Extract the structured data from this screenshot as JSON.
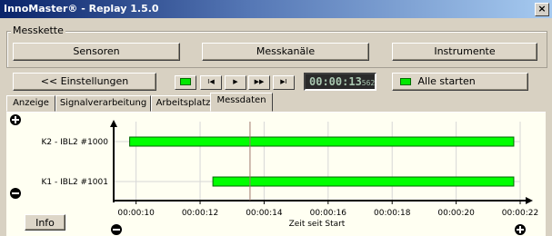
{
  "window": {
    "title": "InnoMaster® - Replay   1.5.0",
    "close_glyph": "×"
  },
  "group": {
    "label": "Messkette"
  },
  "buttons": {
    "sensoren": "Sensoren",
    "messkanaele": "Messkanäle",
    "instrumente": "Instrumente",
    "einstellungen": "<< Einstellungen",
    "alle_starten": "Alle starten",
    "info": "Info"
  },
  "media": {
    "rewind": "I◀",
    "play": "▶",
    "forward": "▶▶",
    "end": "▶I"
  },
  "timer": {
    "main": "00:00:13",
    "fraction": "562"
  },
  "tabs": [
    "Anzeige",
    "Signalverarbeitung",
    "Arbeitsplatz",
    "Messdaten"
  ],
  "active_tab": "Messdaten",
  "colors": {
    "bar": "#00ff00",
    "cursor": "#a0786e",
    "panel_bg": "#fffff2"
  },
  "chart_data": {
    "type": "gantt",
    "xlabel": "Zeit seit Start",
    "x_ticks": [
      "00:00:10",
      "00:00:12",
      "00:00:14",
      "00:00:16",
      "00:00:18",
      "00:00:20",
      "00:00:22"
    ],
    "x_tick_seconds": [
      10,
      12,
      14,
      16,
      18,
      20,
      22
    ],
    "xlim_seconds": [
      9.3,
      22
    ],
    "cursor_seconds": 13.56,
    "rows": [
      {
        "label": "K2 - IBL2 #1000",
        "start": 9.8,
        "end": 21.8
      },
      {
        "label": "K1 - IBL2 #1001",
        "start": 12.4,
        "end": 21.8
      }
    ],
    "grid": true
  }
}
